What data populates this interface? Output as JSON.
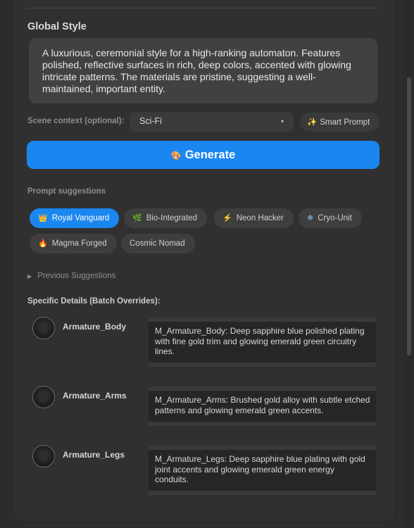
{
  "global_style": {
    "title": "Global Style",
    "text": "A luxurious, ceremonial style for a high-ranking automaton. Features polished, reflective surfaces in rich, deep colors, accented with glowing intricate patterns. The materials are pristine, suggesting a well-maintained, important entity."
  },
  "scene": {
    "label": "Scene context (optional):",
    "value": "Sci-Fi",
    "caret": "▾"
  },
  "smart_prompt": {
    "icon": "✨",
    "label": "Smart Prompt"
  },
  "generate": {
    "icon": "🎨",
    "label": "Generate",
    "color": "#1a87f0"
  },
  "suggestions": {
    "title": "Prompt suggestions",
    "chips": [
      {
        "icon": "👑",
        "label": "Royal Vanguard",
        "active": true
      },
      {
        "icon": "🌿",
        "label": "Bio-Integrated",
        "active": false
      },
      {
        "icon": "⚡",
        "label": "Neon Hacker",
        "active": false
      },
      {
        "icon": "❄",
        "label": "Cryo-Unit",
        "active": false
      },
      {
        "icon": "🔥",
        "label": "Magma Forged",
        "active": false
      },
      {
        "icon": "",
        "label": "Cosmic Nomad",
        "active": false
      }
    ]
  },
  "previous": {
    "label": "Previous Suggestions",
    "icon": "▶"
  },
  "specific": {
    "title": "Specific Details (Batch Overrides):",
    "rows": [
      {
        "name": "Armature_Body",
        "text": "M_Armature_Body: Deep sapphire blue polished plating with fine gold trim and glowing emerald green circuitry lines."
      },
      {
        "name": "Armature_Arms",
        "text": "M_Armature_Arms: Brushed gold alloy with subtle etched patterns and glowing emerald green accents."
      },
      {
        "name": "Armature_Legs",
        "text": "M_Armature_Legs: Deep sapphire blue plating with gold joint accents and glowing emerald green energy conduits."
      }
    ]
  }
}
